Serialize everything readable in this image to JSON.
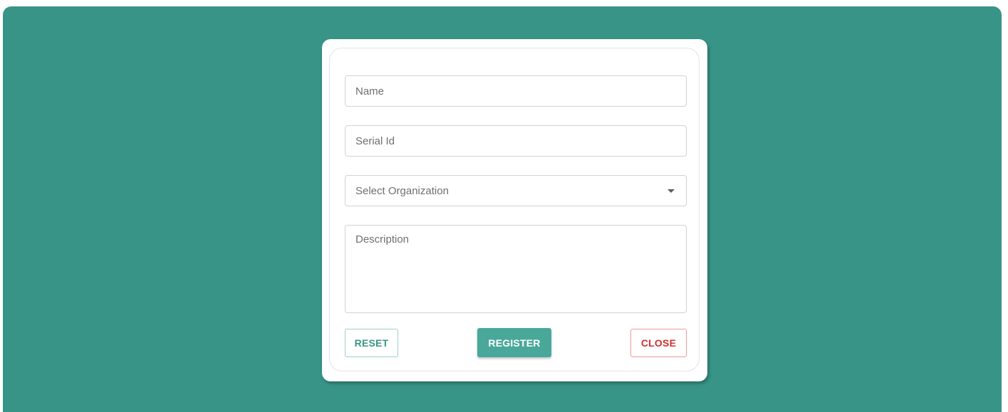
{
  "form": {
    "name_placeholder": "Name",
    "serial_placeholder": "Serial Id",
    "organization_select": {
      "selected": "Select Organization",
      "icon": "caret-down-icon"
    },
    "description_placeholder": "Description"
  },
  "actions": {
    "reset_label": "RESET",
    "register_label": "REGISTER",
    "close_label": "CLOSE"
  },
  "colors": {
    "backdrop": "#389487",
    "primary": "#4aa89a",
    "danger": "#d32f2f"
  }
}
